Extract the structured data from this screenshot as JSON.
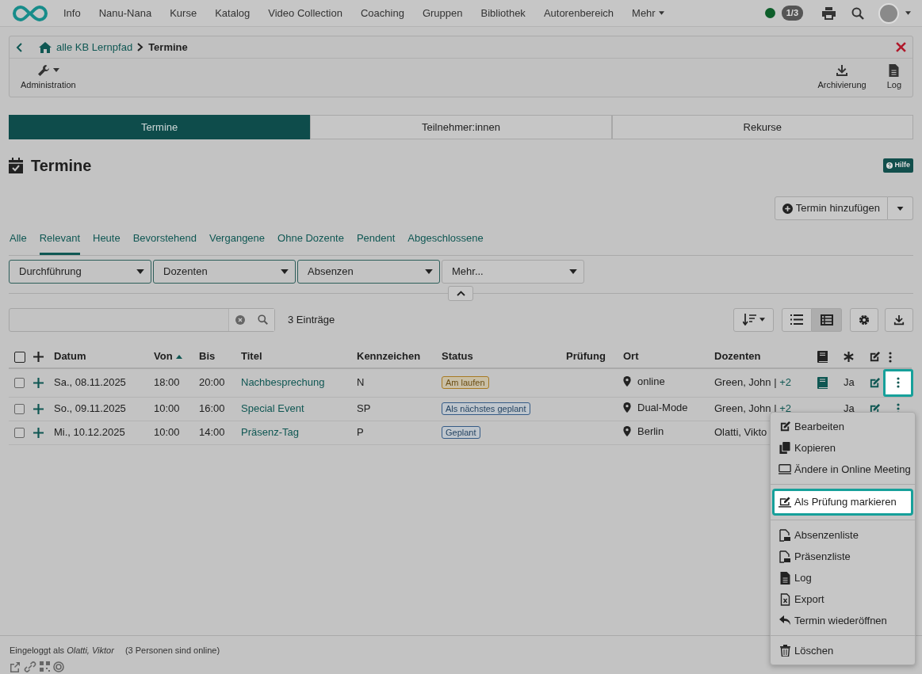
{
  "navbar": {
    "links": [
      "Info",
      "Nanu-Nana",
      "Kurse",
      "Katalog",
      "Video Collection",
      "Coaching",
      "Gruppen",
      "Bibliothek",
      "Autorenbereich"
    ],
    "more": "Mehr",
    "badge": "1/3"
  },
  "breadcrumb": {
    "link": "alle KB Lernpfad",
    "current": "Termine"
  },
  "toolbar": {
    "left": [
      {
        "label": "Administration",
        "kind": "wrench"
      }
    ],
    "right": [
      {
        "label": "Archivierung",
        "kind": "download"
      },
      {
        "label": "Log",
        "kind": "file"
      }
    ]
  },
  "segments": [
    {
      "label": "Termine",
      "selected": true
    },
    {
      "label": "Teilnehmer:innen",
      "selected": false
    },
    {
      "label": "Rekurse",
      "selected": false
    }
  ],
  "heading": "Termine",
  "help": "Hilfe",
  "add_button": "Termin hinzufügen",
  "filter_tabs": [
    {
      "label": "Alle",
      "selected": false
    },
    {
      "label": "Relevant",
      "selected": true
    },
    {
      "label": "Heute",
      "selected": false
    },
    {
      "label": "Bevorstehend",
      "selected": false
    },
    {
      "label": "Vergangene",
      "selected": false
    },
    {
      "label": "Ohne Dozente",
      "selected": false
    },
    {
      "label": "Pendent",
      "selected": false
    },
    {
      "label": "Abgeschlossene",
      "selected": false
    }
  ],
  "filters": [
    {
      "label": "Durchführung",
      "kind": "field"
    },
    {
      "label": "Dozenten",
      "kind": "field"
    },
    {
      "label": "Absenzen",
      "kind": "field"
    },
    {
      "label": "Mehr...",
      "kind": "more"
    }
  ],
  "search": {
    "count": "3 Einträge"
  },
  "view_buttons": [
    {
      "kind": "list",
      "selected": false
    },
    {
      "kind": "table",
      "selected": true
    }
  ],
  "table": {
    "select_all_checked": false,
    "columns": [
      {
        "label": "Datum",
        "sorted": false
      },
      {
        "label": "Von",
        "sorted": true
      },
      {
        "label": "Bis",
        "sorted": false
      },
      {
        "label": "Titel",
        "sorted": false
      },
      {
        "label": "Kennzeichen",
        "sorted": false
      },
      {
        "label": "Status",
        "sorted": false
      },
      {
        "label": "Prüfung",
        "sorted": false
      },
      {
        "label": "Ort",
        "sorted": false
      },
      {
        "label": "Dozenten",
        "sorted": false
      }
    ],
    "rows": [
      {
        "checked": false,
        "datum": "Sa., 08.11.2025",
        "von": "18:00",
        "bis": "20:00",
        "titel": "Nachbesprechung",
        "kennzeichen": "N",
        "status": {
          "label": "Am laufen",
          "kind": "running"
        },
        "ort": "online",
        "dozenten": "Green, John |",
        "more": "+2",
        "book": true,
        "column_11": "Ja",
        "actions": true,
        "menu_highlighted": true
      },
      {
        "checked": false,
        "datum": "So., 09.11.2025",
        "von": "10:00",
        "bis": "16:00",
        "titel": "Special Event",
        "kennzeichen": "SP",
        "status": {
          "label": "Als nächstes geplant",
          "kind": "planned"
        },
        "ort": "Dual-Mode",
        "dozenten": "Green, John |",
        "more": "+2",
        "book": false,
        "column_11": "Ja",
        "actions": true,
        "menu_highlighted": false
      },
      {
        "checked": false,
        "datum": "Mi., 10.12.2025",
        "von": "10:00",
        "bis": "14:00",
        "titel": "Präsenz-Tag",
        "kennzeichen": "P",
        "status": {
          "label": "Geplant",
          "kind": "planned"
        },
        "ort": "Berlin",
        "dozenten": "Olatti, Vikto",
        "book": false,
        "actions": false
      }
    ]
  },
  "menu": {
    "items": [
      {
        "kind": "edit",
        "label": "Bearbeiten",
        "highlighted": false
      },
      {
        "kind": "copy",
        "label": "Kopieren",
        "highlighted": false
      },
      {
        "kind": "monitor",
        "label": "Ändere in Online Meeting",
        "highlighted": false
      },
      {
        "kind": "divider"
      },
      {
        "kind": "exam",
        "label": "Als Prüfung markieren",
        "highlighted": true
      },
      {
        "kind": "divider"
      },
      {
        "kind": "pdf",
        "label": "Absenzenliste",
        "highlighted": false
      },
      {
        "kind": "pdf",
        "label": "Präsenzliste",
        "highlighted": false
      },
      {
        "kind": "file",
        "label": "Log",
        "highlighted": false
      },
      {
        "kind": "xls",
        "label": "Export",
        "highlighted": false
      },
      {
        "kind": "undo",
        "label": "Termin wiederöffnen",
        "highlighted": false
      },
      {
        "kind": "divider"
      },
      {
        "kind": "trash",
        "label": "Löschen",
        "highlighted": false
      }
    ]
  },
  "footer": {
    "user": "Eingeloggt als *Olatti, Viktor*",
    "online": "(3 Personen sind online)"
  }
}
